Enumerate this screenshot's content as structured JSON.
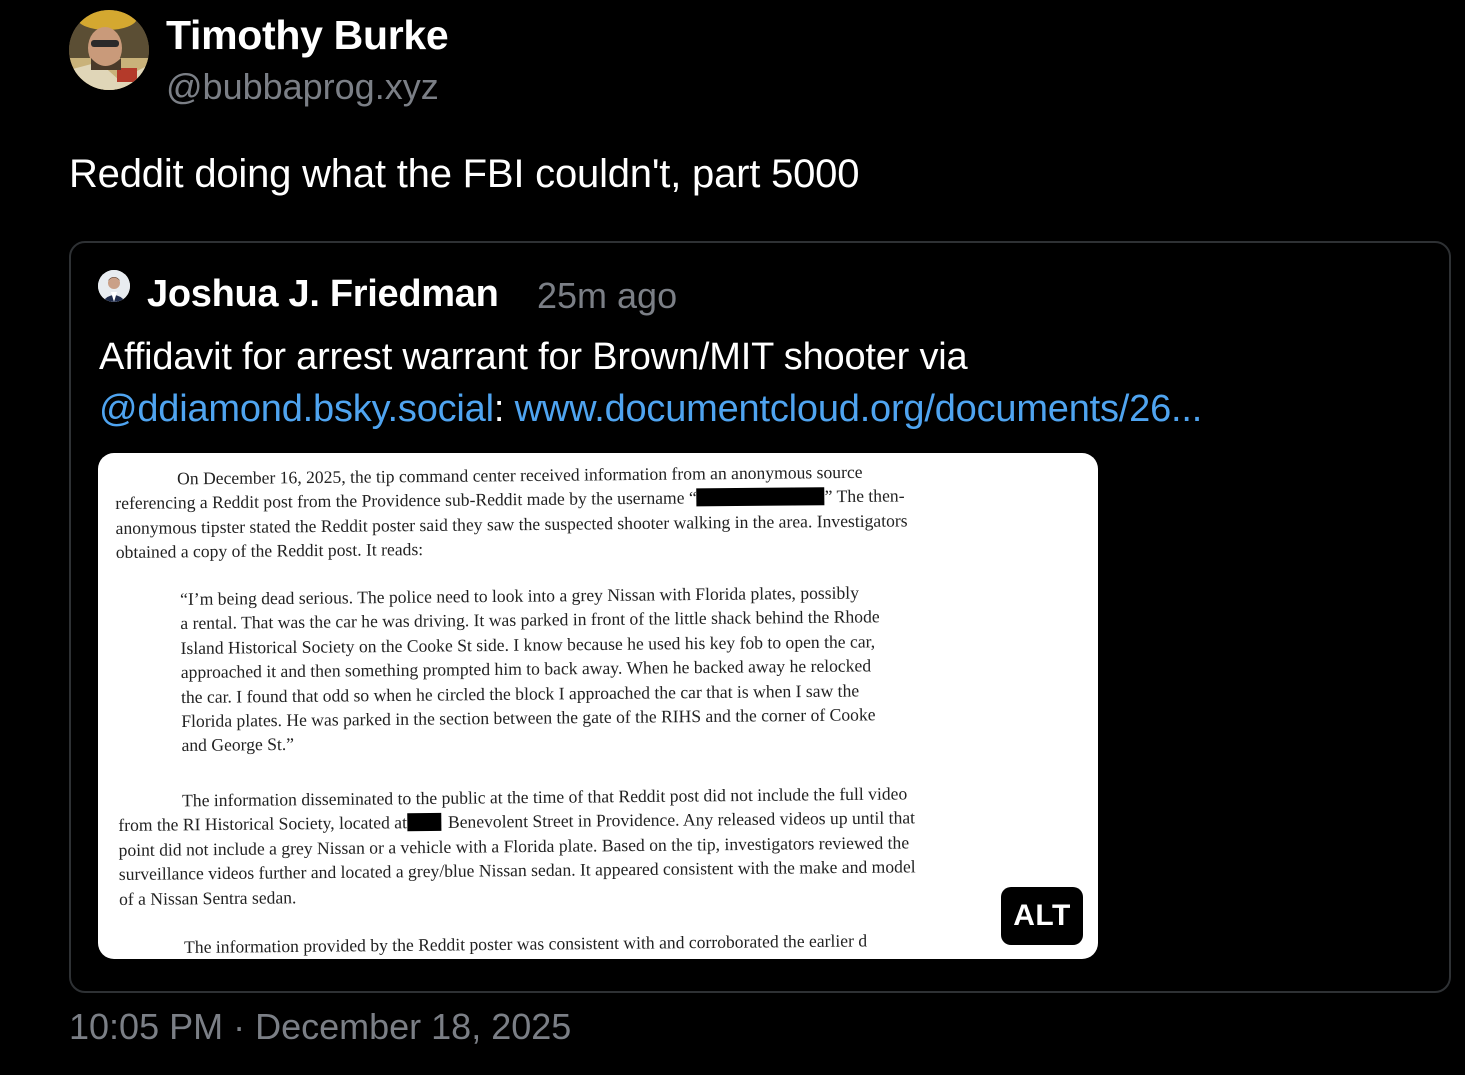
{
  "post": {
    "author": {
      "display_name": "Timothy Burke",
      "handle": "@bubbaprog.xyz"
    },
    "text": "Reddit doing what the FBI couldn't, part 5000",
    "timestamp": "10:05 PM · December 18, 2025"
  },
  "quote": {
    "author": "Joshua J. Friedman",
    "time_ago": "25m ago",
    "text_prefix": "Affidavit for arrest warrant for Brown/MIT shooter via",
    "mention": "@ddiamond.bsky.social",
    "separator": ": ",
    "link": "www.documentcloud.org/documents/26...",
    "image": {
      "alt_badge": "ALT",
      "para1": [
        "On December 16, 2025, the tip command center received information from an anonymous source",
        "referencing a Reddit post from the Providence sub-Reddit made by the username “",
        "” The then-",
        "anonymous tipster stated the Reddit poster said they saw the suspected shooter walking in the area. Investigators",
        "obtained a copy of the Reddit post. It reads:"
      ],
      "quote_lines": [
        "“I’m being dead serious. The police need to look into a grey Nissan with Florida plates, possibly",
        "a rental. That was the car he was driving. It was parked in front of the little shack behind the Rhode",
        "Island Historical Society on the Cooke St side. I know because he used his key fob to open the car,",
        "approached it and then something prompted him to back away. When he backed away he relocked",
        "the car. I found that odd so when he circled the block I approached the car that is when I saw the",
        "Florida plates. He was parked in the section between the gate of the RIHS and the corner of Cooke",
        "and George St.”"
      ],
      "para2": [
        "The information disseminated to the public at the time of that Reddit post did not include the full video",
        "from the RI Historical Society, located at",
        "Benevolent Street in Providence. Any released videos up until that",
        "point did not include a grey Nissan or a vehicle with a Florida plate. Based on the tip, investigators reviewed the",
        "surveillance videos further and located a grey/blue Nissan sedan. It appeared consistent with the make and model",
        "of a Nissan Sentra sedan."
      ],
      "para3": "The information provided by the Reddit poster was consistent with and corroborated the earlier d"
    }
  },
  "colors": {
    "background": "#000000",
    "text": "#ffffff",
    "muted": "#7b7f86",
    "link": "#4fa4f0",
    "border": "#2e3134"
  }
}
